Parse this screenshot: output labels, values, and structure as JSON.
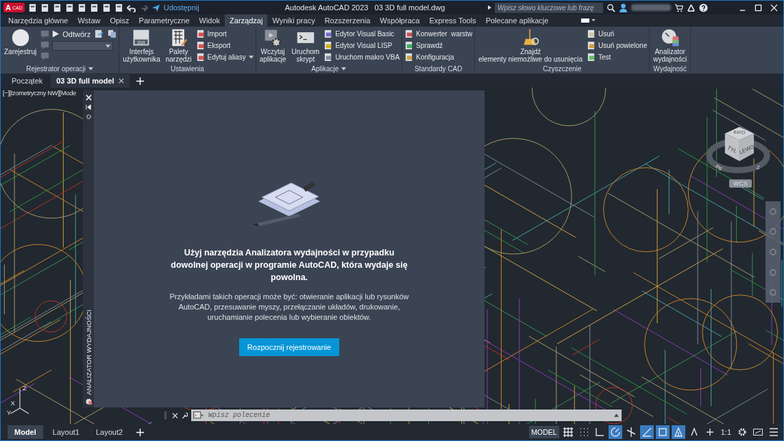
{
  "app": {
    "logo_letter": "A",
    "logo_text": "CAD",
    "share": "Udostępnij",
    "title": "Autodesk AutoCAD 2023",
    "file": "03 3D full model.dwg",
    "search": {
      "placeholder": "Wpisz słowo kluczowe lub frazę"
    }
  },
  "ribbon_tabs": [
    {
      "label": "Narzędzia główne",
      "selected": false
    },
    {
      "label": "Wstaw",
      "selected": false
    },
    {
      "label": "Opisz",
      "selected": false
    },
    {
      "label": "Parametryczne",
      "selected": false
    },
    {
      "label": "Widok",
      "selected": false
    },
    {
      "label": "Zarządzaj",
      "selected": true
    },
    {
      "label": "Wyniki pracy",
      "selected": false
    },
    {
      "label": "Rozszerzenia",
      "selected": false
    },
    {
      "label": "Współpraca",
      "selected": false
    },
    {
      "label": "Express Tools",
      "selected": false
    },
    {
      "label": "Polecane aplikacje",
      "selected": false
    }
  ],
  "panels": [
    {
      "title": "Rejestrator operacji",
      "menu": true,
      "groups": [
        {
          "kind": "large",
          "lines": [
            "Zarejestruj"
          ]
        },
        {
          "kind": "icons",
          "disabled": true
        },
        {
          "kind": "player",
          "label": "Odtwórz"
        }
      ]
    },
    {
      "title": "Ustawienia",
      "menu": false,
      "groups": [
        {
          "kind": "large",
          "badge": "CUI",
          "lines": [
            "Interfejs",
            "użytkownika"
          ]
        },
        {
          "kind": "large",
          "lines": [
            "Palety",
            "narzędzi"
          ]
        },
        {
          "kind": "stack",
          "items": [
            {
              "label": "Import",
              "menu": false
            },
            {
              "label": "Eksport",
              "menu": false
            },
            {
              "label": "Edytuj aliasy",
              "menu": true
            }
          ]
        }
      ]
    },
    {
      "title": "Aplikacje",
      "menu": true,
      "groups": [
        {
          "kind": "large",
          "lines": [
            "Wczytaj",
            "aplikacje"
          ]
        },
        {
          "kind": "large",
          "lines": [
            "Uruchom",
            "skrypt"
          ]
        },
        {
          "kind": "stack",
          "items": [
            {
              "label": "Edytor Visual Basic",
              "menu": false
            },
            {
              "label": "Edytor Visual LISP",
              "menu": false
            },
            {
              "label": "Uruchom makro VBA",
              "menu": false
            }
          ]
        }
      ]
    },
    {
      "title": "Standardy CAD",
      "menu": false,
      "groups": [
        {
          "kind": "stack",
          "items": [
            {
              "label": "Konwerter  warstw",
              "menu": false
            },
            {
              "label": "Sprawdź",
              "menu": false
            },
            {
              "label": "Konfiguracja",
              "menu": false
            }
          ]
        }
      ]
    },
    {
      "title": "Czyszczenie",
      "menu": false,
      "groups": [
        {
          "kind": "large",
          "lines": [
            "Znajdź",
            "elementy niemożliwe do usunięcia"
          ]
        },
        {
          "kind": "stack",
          "items": [
            {
              "label": "Usuń",
              "menu": false
            },
            {
              "label": "Usuń powielone",
              "menu": false
            },
            {
              "label": "Test",
              "menu": false
            }
          ]
        }
      ]
    },
    {
      "title": "Wydajność",
      "menu": false,
      "groups": [
        {
          "kind": "large",
          "lines": [
            "Analizator",
            "wydajności"
          ]
        }
      ]
    }
  ],
  "document_tabs": [
    {
      "label": "Początek",
      "selected": false
    },
    {
      "label": "03 3D full model",
      "selected": true
    }
  ],
  "viewport": {
    "label": "[−][Izometryczny NW][Mode"
  },
  "palette": {
    "title": "ANALIZATOR WYDAJNOŚCI",
    "heading": "Użyj narzędzia Analizatora wydajności w przypadku dowolnej operacji w programie AutoCAD, która wydaje się powolna.",
    "body": "Przykładami takich operacji może być: otwieranie aplikacji lub rysunków AutoCAD, przesuwanie myszy, przełączanie układów, drukowanie, uruchamianie polecenia lub wybieranie obiektów.",
    "button": "Rozpocznij rejestrowanie"
  },
  "viewcube": {
    "top": "Góra",
    "front": "TYŁ",
    "side": "LEWO",
    "compass": [
      "Pd",
      "Z"
    ],
    "ucs": "WCS"
  },
  "ucs_icon": {
    "axes": [
      "Z",
      "X",
      "Y"
    ]
  },
  "command_line": {
    "placeholder": "Wpisz polecenie"
  },
  "layout_tabs": [
    {
      "label": "Model",
      "selected": true
    },
    {
      "label": "Layout1",
      "selected": false
    },
    {
      "label": "Layout2",
      "selected": false
    }
  ],
  "status_bar": {
    "model": "MODEL",
    "scale": "1:1",
    "toggles": [
      {
        "on": false
      },
      {
        "on": false
      },
      {
        "on": false
      },
      {
        "on": true
      },
      {
        "on": false
      },
      {
        "on": true
      },
      {
        "on": true
      },
      {
        "on": true
      },
      {
        "on": false
      },
      {
        "on": false
      }
    ]
  }
}
